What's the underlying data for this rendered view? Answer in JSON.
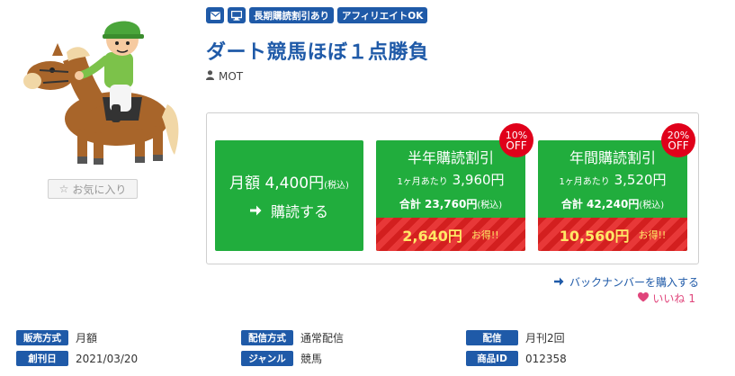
{
  "thumbnail": {
    "alt": "horse-rider-illustration"
  },
  "favorite": {
    "icon": "star-icon",
    "label": "お気に入り"
  },
  "tags": {
    "mail_icon": "mail-icon",
    "device_icon": "monitor-icon",
    "items": [
      "長期購読割引あり",
      "アフィリエイトOK"
    ]
  },
  "title": "ダート競馬ほぼ１点勝負",
  "author": {
    "icon": "person-icon",
    "name": "MOT"
  },
  "plans": {
    "monthly": {
      "prefix": "月額",
      "price": "4,400円",
      "tax": "(税込)",
      "cta": "購読する"
    },
    "half": {
      "title": "半年購読割引",
      "per_label": "1ヶ月あたり",
      "per_price": "3,960円",
      "total_label": "合計",
      "total_price": "23,760円",
      "tax": "(税込)",
      "deal_amount": "2,640円",
      "deal_label": "お得!!",
      "badge_pct": "10%",
      "badge_off": "OFF"
    },
    "year": {
      "title": "年間購読割引",
      "per_label": "1ヶ月あたり",
      "per_price": "3,520円",
      "total_label": "合計",
      "total_price": "42,240円",
      "tax": "(税込)",
      "deal_amount": "10,560円",
      "deal_label": "お得!!",
      "badge_pct": "20%",
      "badge_off": "OFF"
    }
  },
  "backnumber": "バックナンバーを購入する",
  "like": {
    "label": "いいね",
    "count": "1"
  },
  "info": [
    {
      "label": "販売方式",
      "value": "月額"
    },
    {
      "label": "配信方式",
      "value": "通常配信"
    },
    {
      "label": "配信",
      "value": "月刊2回"
    },
    {
      "label": "創刊日",
      "value": "2021/03/20"
    },
    {
      "label": "ジャンル",
      "value": "競馬"
    },
    {
      "label": "商品ID",
      "value": "012358"
    }
  ],
  "colors": {
    "accent": "#1f5aa8",
    "green": "#21ad3d",
    "red": "#d31f1f",
    "badge": "#e0001a"
  }
}
